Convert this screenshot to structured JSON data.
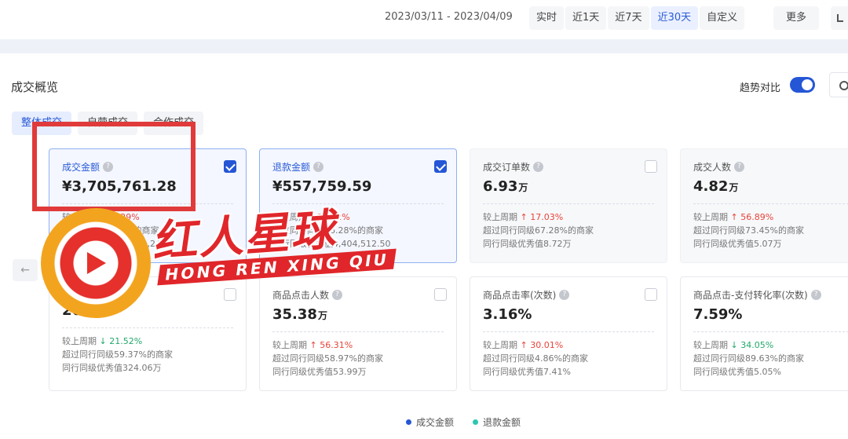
{
  "header": {
    "date_range": "2023/03/11 - 2023/04/09",
    "date_tabs": [
      {
        "label": "实时"
      },
      {
        "label": "近1天"
      },
      {
        "label": "近7天"
      },
      {
        "label": "近30天"
      },
      {
        "label": "自定义"
      }
    ],
    "active_tab": "近30天",
    "more_label": "更多"
  },
  "section": {
    "title": "成交概览",
    "trend_compare_label": "趋势对比",
    "trend_compare_on": true
  },
  "sub_tabs": [
    {
      "label": "整体成交"
    },
    {
      "label": "自营成交"
    },
    {
      "label": "合作成交"
    }
  ],
  "cards": [
    {
      "title": "成交金额",
      "value": "¥3,705,761.28",
      "unit": "",
      "checked": true,
      "change_label": "较上周期",
      "change_dir": "up",
      "change_value": "54.29%",
      "line2": "超过同行同级83%的商家",
      "line3": "同行同级优秀值1,062,245.8"
    },
    {
      "title": "退款金额",
      "value": "¥557,759.59",
      "unit": "",
      "checked": true,
      "change_label": "较上周期",
      "change_dir": "up",
      "change_value": "38.92%",
      "line2": "超过同行同级16.28%的商家",
      "line3": "同行同级优秀值4,404,512.50"
    },
    {
      "title": "成交订单数",
      "value": "6.93",
      "unit": "万",
      "checked": false,
      "change_label": "较上周期",
      "change_dir": "up",
      "change_value": "17.03%",
      "line2": "超过同行同级67.28%的商家",
      "line3": "同行同级优秀值8.72万"
    },
    {
      "title": "成交人数",
      "value": "4.82",
      "unit": "万",
      "checked": false,
      "change_label": "较上周期",
      "change_dir": "up",
      "change_value": "56.89%",
      "line2": "超过同行同级73.45%的商家",
      "line3": "同行同级优秀值5.07万"
    },
    {
      "title": "",
      "value": "26",
      "unit": "",
      "checked": false,
      "change_label": "较上周期",
      "change_dir": "down",
      "change_value": "21.52%",
      "line2": "超过同行同级59.37%的商家",
      "line3": "同行同级优秀值324.06万"
    },
    {
      "title": "商品点击人数",
      "value": "35.38",
      "unit": "万",
      "checked": false,
      "change_label": "较上周期",
      "change_dir": "up",
      "change_value": "56.31%",
      "line2": "超过同行同级58.97%的商家",
      "line3": "同行同级优秀值53.99万"
    },
    {
      "title": "商品点击率(次数)",
      "value": "3.16%",
      "unit": "",
      "checked": false,
      "change_label": "较上周期",
      "change_dir": "up",
      "change_value": "30.01%",
      "line2": "超过同行同级4.86%的商家",
      "line3": "同行同级优秀值7.41%"
    },
    {
      "title": "商品点击-支付转化率(次数)",
      "value": "7.59%",
      "unit": "",
      "checked": false,
      "change_label": "较上周期",
      "change_dir": "down",
      "change_value": "34.05%",
      "line2": "超过同行同级89.63%的商家",
      "line3": "同行同级优秀值5.05%"
    }
  ],
  "watermark": {
    "cn_text": "红人星球",
    "en_text": "HONG REN XING QIU"
  },
  "legend": [
    {
      "label": "成交金额",
      "color": "#2456d6"
    },
    {
      "label": "退款金额",
      "color": "#2cc6b0"
    }
  ],
  "colors": {
    "accent": "#2456d6",
    "up": "#e8443a",
    "down": "#23a86b",
    "highlight": "#e03a3a"
  }
}
